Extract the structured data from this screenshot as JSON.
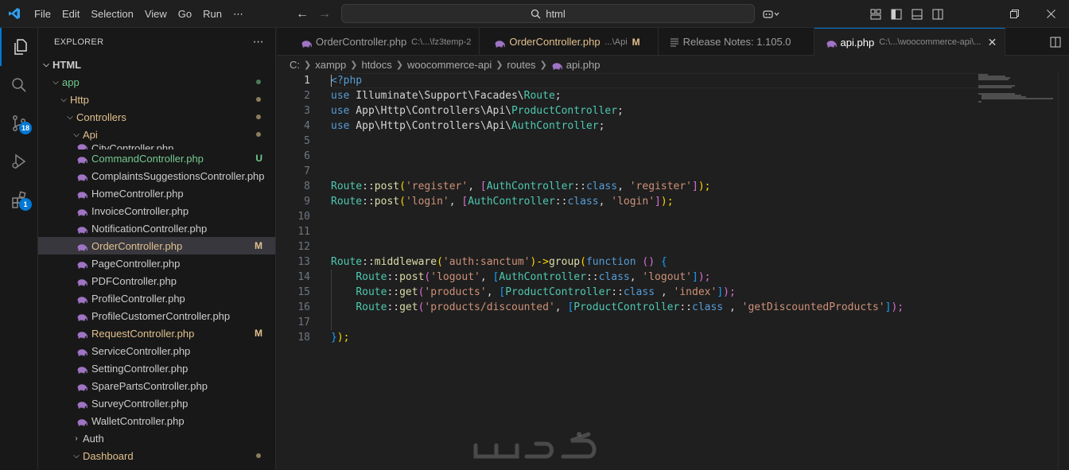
{
  "menu": [
    "File",
    "Edit",
    "Selection",
    "View",
    "Go",
    "Run",
    "⋯"
  ],
  "search": {
    "text": "html"
  },
  "colors": {
    "accent": "#0078d4",
    "modified": "#e2c08d",
    "untracked": "#73c991",
    "php_icon": "#a074c4"
  },
  "activity": {
    "scm_badge": "18",
    "extensions_badge": "1"
  },
  "explorer": {
    "title": "EXPLORER",
    "more": "⋯",
    "root": "HTML",
    "folders": {
      "app": "app",
      "http": "Http",
      "controllers": "Controllers",
      "api": "Api",
      "auth": "Auth",
      "dashboard": "Dashboard"
    },
    "partial_file": "CityController.php",
    "files": [
      {
        "name": "CommandController.php",
        "status": "U"
      },
      {
        "name": "ComplaintsSuggestionsController.php",
        "status": ""
      },
      {
        "name": "HomeController.php",
        "status": ""
      },
      {
        "name": "InvoiceController.php",
        "status": ""
      },
      {
        "name": "NotificationController.php",
        "status": ""
      },
      {
        "name": "OrderController.php",
        "status": "M"
      },
      {
        "name": "PageController.php",
        "status": ""
      },
      {
        "name": "PDFController.php",
        "status": ""
      },
      {
        "name": "ProfileController.php",
        "status": ""
      },
      {
        "name": "ProfileCustomerController.php",
        "status": ""
      },
      {
        "name": "RequestController.php",
        "status": "M"
      },
      {
        "name": "ServiceController.php",
        "status": ""
      },
      {
        "name": "SettingController.php",
        "status": ""
      },
      {
        "name": "SparePartsController.php",
        "status": ""
      },
      {
        "name": "SurveyController.php",
        "status": ""
      },
      {
        "name": "WalletController.php",
        "status": ""
      }
    ]
  },
  "tabs": [
    {
      "label": "OrderController.php",
      "desc": "C:\\...\\fz3temp-2",
      "mark": ""
    },
    {
      "label": "OrderController.php",
      "desc": "...\\Api",
      "mark": "M"
    },
    {
      "label": "Release Notes: 1.105.0",
      "desc": "",
      "mark": ""
    },
    {
      "label": "api.php",
      "desc": "C:\\...\\woocommerce-api\\...",
      "mark": ""
    }
  ],
  "breadcrumb": [
    "C:",
    "xampp",
    "htdocs",
    "woocommerce-api",
    "routes",
    "api.php"
  ],
  "line_numbers": [
    "1",
    "2",
    "3",
    "4",
    "5",
    "6",
    "7",
    "8",
    "9",
    "10",
    "11",
    "12",
    "13",
    "14",
    "15",
    "16",
    "17",
    "18"
  ],
  "code": {
    "l1": [
      "<?php"
    ],
    "l2": [
      "use",
      " Illuminate\\Support\\Facades\\",
      "Route",
      ";"
    ],
    "l3": [
      "use",
      " App\\Http\\Controllers\\Api\\",
      "ProductController",
      ";"
    ],
    "l4": [
      "use",
      " App\\Http\\Controllers\\Api\\",
      "AuthController",
      ";"
    ],
    "l8": [
      "Route",
      "::",
      "post",
      "(",
      "'register'",
      ", ",
      "[",
      "AuthController",
      "::",
      "class",
      ", ",
      "'register'",
      "]",
      ");"
    ],
    "l9": [
      "Route",
      "::",
      "post",
      "(",
      "'login'",
      ", ",
      "[",
      "AuthController",
      "::",
      "class",
      ", ",
      "'login'",
      "]",
      ");"
    ],
    "l13": [
      "Route",
      "::",
      "middleware",
      "(",
      "'auth:sanctum'",
      ")->",
      "group",
      "(",
      "function",
      " ",
      "()",
      " {"
    ],
    "l14": [
      "    ",
      "Route",
      "::",
      "post",
      "(",
      "'logout'",
      ", ",
      "[",
      "AuthController",
      "::",
      "class",
      ", ",
      "'logout'",
      "]",
      ");"
    ],
    "l15": [
      "    ",
      "Route",
      "::",
      "get",
      "(",
      "'products'",
      ", ",
      "[",
      "ProductController",
      "::",
      "class",
      " , ",
      "'index'",
      "]",
      ");"
    ],
    "l16": [
      "    ",
      "Route",
      "::",
      "get",
      "(",
      "'products/discounted'",
      ", ",
      "[",
      "ProductController",
      "::",
      "class",
      " , ",
      "'getDiscountedProducts'",
      "]",
      ");"
    ],
    "l18": [
      "}",
      ");"
    ]
  }
}
